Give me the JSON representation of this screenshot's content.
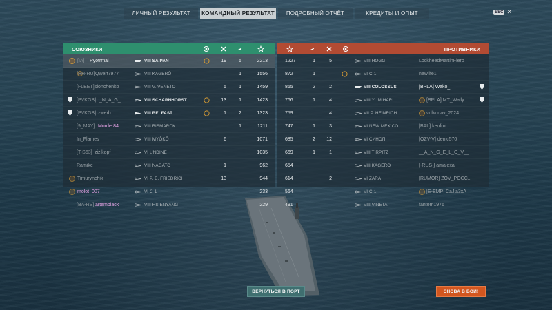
{
  "tabs": [
    {
      "label": "ЛИЧНЫЙ РЕЗУЛЬТАТ",
      "active": false
    },
    {
      "label": "КОМАНДНЫЙ РЕЗУЛЬТАТ",
      "active": true
    },
    {
      "label": "ПОДРОБНЫЙ ОТЧЁТ",
      "active": false
    },
    {
      "label": "КРЕДИТЫ И ОПЫТ",
      "active": false
    }
  ],
  "esc_label": "ESC",
  "close_glyph": "✕",
  "allies": {
    "title": "СОЮЗНИКИ",
    "colors": {
      "header": "#2e8f6e"
    },
    "rows": [
      {
        "clan": "[IA]",
        "name": "Pyotrmai",
        "ship": "VIII SAIPAN",
        "medal": "",
        "kills": "19",
        "planes": "5",
        "xp": "2213"
      },
      {
        "clan": "[HH-RU]",
        "name": "Qwert7977",
        "ship": "VIII KAGERŌ",
        "medal": "",
        "kills": "",
        "planes": "1",
        "xp": "1556"
      },
      {
        "clan": "[FLEET]",
        "name": "slonchenko",
        "ship": "VIII V. VENETO",
        "medal": "",
        "kills": "5",
        "planes": "1",
        "xp": "1459"
      },
      {
        "clan": "[PVKGB]",
        "name": "_N_A_G_",
        "ship": "VIII SCHARNHORST",
        "medal": "",
        "kills": "13",
        "planes": "1",
        "xp": "1423"
      },
      {
        "clan": "[PVKGB]",
        "name": "zwerb",
        "ship": "VIII BELFAST",
        "medal": "",
        "kills": "1",
        "planes": "2",
        "xp": "1323"
      },
      {
        "clan": "[9_MAY]",
        "name": "Murder84",
        "ship": "VIII BISMARCK",
        "medal": "",
        "kills": "",
        "planes": "1",
        "xp": "1211"
      },
      {
        "clan": "",
        "name": "In_Flames",
        "ship": "VIII MYŌKŌ",
        "medal": "",
        "kills": "6",
        "planes": "",
        "xp": "1071"
      },
      {
        "clan": "[T-S63]",
        "name": "zizikopf",
        "ship": "VI UNDINE",
        "medal": "",
        "kills": "",
        "planes": "",
        "xp": "1035"
      },
      {
        "clan": "",
        "name": "Ramike",
        "ship": "VIII NAGATO",
        "medal": "",
        "kills": "1",
        "planes": "",
        "xp": "962"
      },
      {
        "clan": "",
        "name": "Timurynchik",
        "ship": "VI P. E. FRIEDRICH",
        "medal": "",
        "kills": "13",
        "planes": "",
        "xp": "944"
      },
      {
        "clan": "",
        "name": "molot_007",
        "ship": "VI C-1",
        "medal": "",
        "kills": "",
        "planes": "",
        "xp": "233"
      },
      {
        "clan": "[BA-RS]",
        "name": "artemblack",
        "ship": "VIII HSIENYANG",
        "medal": "",
        "kills": "",
        "planes": "",
        "xp": "229"
      }
    ]
  },
  "enemies": {
    "title": "ПРОТИВНИКИ",
    "colors": {
      "header": "#b24b33"
    },
    "rows": [
      {
        "xp": "1227",
        "planes": "1",
        "kills": "5",
        "ship": "VIII HOGG",
        "name": "LockheedMartinFiero"
      },
      {
        "xp": "872",
        "planes": "1",
        "kills": "",
        "ship": "VI C-1",
        "name": "newlife1"
      },
      {
        "xp": "865",
        "planes": "2",
        "kills": "2",
        "ship": "VIII COLOSSUS",
        "name": "[BPLA] Wako_"
      },
      {
        "xp": "766",
        "planes": "1",
        "kills": "4",
        "ship": "VIII YUMIHARI",
        "name": "[BPLA] MT_Wally"
      },
      {
        "xp": "759",
        "planes": "",
        "kills": "4",
        "ship": "VII P. HEINRICH",
        "name": "volkodav_2024"
      },
      {
        "xp": "747",
        "planes": "1",
        "kills": "3",
        "ship": "VI NEW MEXICO",
        "name": "[BAL] keofrol"
      },
      {
        "xp": "685",
        "planes": "2",
        "kills": "12",
        "ship": "VI СИНОП",
        "name": "[OZV-V] denic570"
      },
      {
        "xp": "669",
        "planes": "1",
        "kills": "1",
        "ship": "VIII TIRPITZ",
        "name": "__A_N_G_E_L_O_V__"
      },
      {
        "xp": "654",
        "planes": "",
        "kills": "",
        "ship": "VIII KAGERŌ",
        "name": "[-RUS-] amalexa"
      },
      {
        "xp": "614",
        "planes": "",
        "kills": "2",
        "ship": "VI ZARA",
        "name": "[RUMOR] ZOV_POCC..."
      },
      {
        "xp": "564",
        "planes": "",
        "kills": "",
        "ship": "VI C-1",
        "name": "[E-EMP] CaJla3xA"
      },
      {
        "xp": "491",
        "planes": "",
        "kills": "",
        "ship": "VIII VINETA",
        "name": "fantom1976"
      }
    ]
  },
  "buttons": {
    "port": "ВЕРНУТЬСЯ В ПОРТ",
    "battle": "СНОВА В БОЙ!"
  }
}
